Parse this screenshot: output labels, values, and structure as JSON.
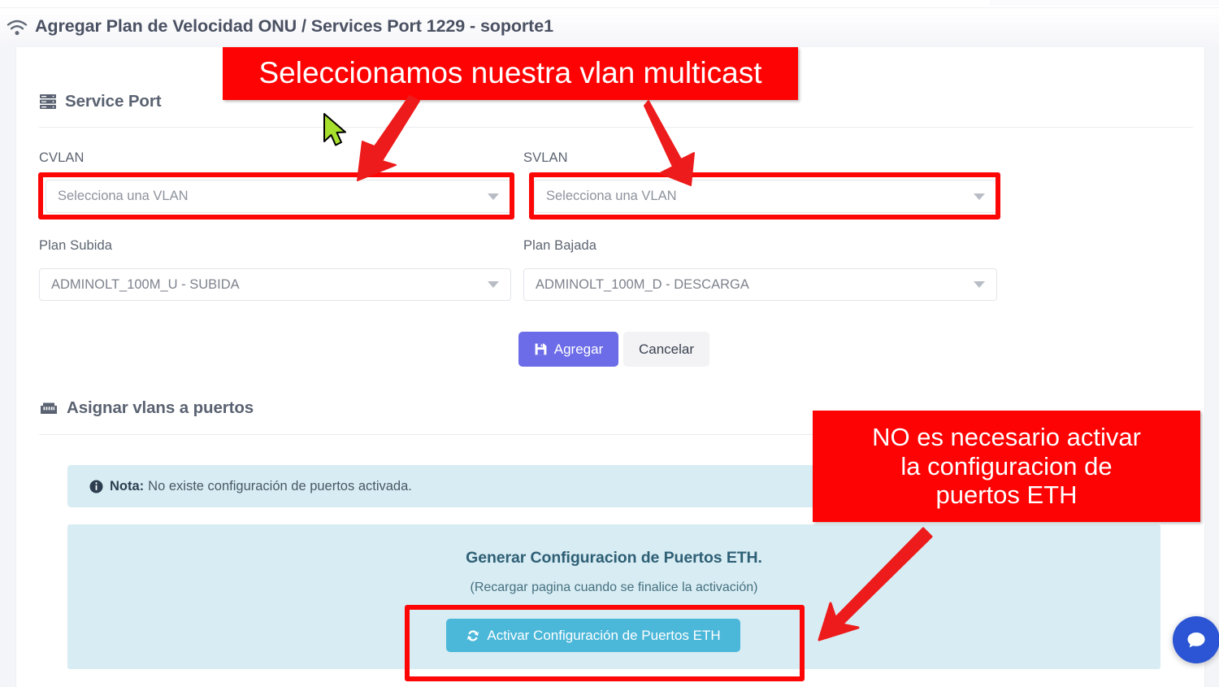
{
  "header": {
    "icon": "wifi-icon",
    "title": "Agregar Plan de Velocidad ONU / Services Port 1229 - soporte1"
  },
  "service_port_section": {
    "icon": "server-stack-icon",
    "title": "Service Port",
    "fields": {
      "cvlan_label": "CVLAN",
      "cvlan_value": "Selecciona una VLAN",
      "svlan_label": "SVLAN",
      "svlan_value": "Selecciona una VLAN",
      "plan_subida_label": "Plan Subida",
      "plan_subida_value": "ADMINOLT_100M_U - SUBIDA",
      "plan_bajada_label": "Plan Bajada",
      "plan_bajada_value": "ADMINOLT_100M_D - DESCARGA"
    },
    "actions": {
      "submit_label": "Agregar",
      "submit_icon": "save-icon",
      "cancel_label": "Cancelar"
    }
  },
  "ports_section": {
    "icon": "ethernet-port-icon",
    "title": "Asignar vlans a puertos",
    "note": {
      "icon": "info-circle-icon",
      "strong": "Nota:",
      "text": "No existe configuración de puertos activada."
    },
    "eth_panel": {
      "title": "Generar Configuracion de Puertos ETH.",
      "subtitle": "(Recargar pagina cuando se finalice la activación)",
      "button_label": "Activar Configuración de Puertos ETH",
      "button_icon": "sync-refresh-icon"
    }
  },
  "annotations": {
    "vlan_note": "Seleccionamos nuestra vlan multicast",
    "eth_note": "NO es necesario activar\nla configuracion de\npuertos ETH"
  },
  "chat_widget": {
    "icon": "chat-bubble-icon"
  },
  "colors": {
    "annotation_red": "#fd0303",
    "primary_purple": "#6c6ce8",
    "info_cyan": "#4bb7d9",
    "alert_bg": "#d8edf3",
    "chat_blue": "#2b55d4",
    "cursor_green": "#a6e02c"
  }
}
